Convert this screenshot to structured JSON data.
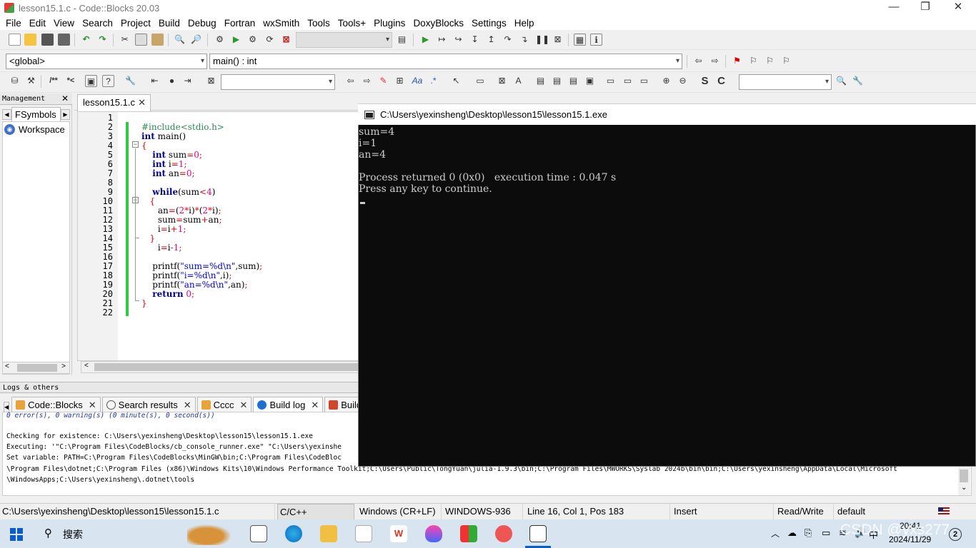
{
  "window": {
    "title": "lesson15.1.c - Code::Blocks 20.03",
    "minimize": "—",
    "maximize": "❐",
    "close": "✕"
  },
  "menu": [
    "File",
    "Edit",
    "View",
    "Search",
    "Project",
    "Build",
    "Debug",
    "Fortran",
    "wxSmith",
    "Tools",
    "Tools+",
    "Plugins",
    "DoxyBlocks",
    "Settings",
    "Help"
  ],
  "toolbar": {
    "scope_combo": "<global>",
    "function_combo": "main() : int"
  },
  "management": {
    "header": "Management",
    "tab": "FSymbols",
    "workspace": "Workspace"
  },
  "editor": {
    "tab": "lesson15.1.c",
    "line_numbers": [
      "1",
      "2",
      "3",
      "4",
      "5",
      "6",
      "7",
      "8",
      "9",
      "10",
      "11",
      "12",
      "13",
      "14",
      "15",
      "16",
      "17",
      "18",
      "19",
      "20",
      "21",
      "22"
    ]
  },
  "console": {
    "title": "C:\\Users\\yexinsheng\\Desktop\\lesson15\\lesson15.1.exe",
    "lines": [
      "sum=4",
      "i=1",
      "an=4",
      "",
      "Process returned 0 (0x0)   execution time : 0.047 s",
      "Press any key to continue."
    ]
  },
  "logs": {
    "header": "Logs & others",
    "tabs": [
      "Code::Blocks",
      "Search results",
      "Cccc",
      "Build log",
      "Build"
    ],
    "lines": [
      "0 error(s), 0 warning(s) (0 minute(s), 0 second(s))",
      "",
      "Checking for existence: C:\\Users\\yexinsheng\\Desktop\\lesson15\\lesson15.1.exe",
      "Executing: '\"C:\\Program Files\\CodeBlocks/cb_console_runner.exe\" \"C:\\Users\\yexinshe",
      "Set variable: PATH=C:\\Program Files\\CodeBlocks\\MinGW\\bin;C:\\Program Files\\CodeBloc",
      "\\Program Files\\dotnet;C:\\Program Files (x86)\\Windows Kits\\10\\Windows Performance Toolkit;C:\\Users\\Public\\TongYuan\\julia-1.9.3\\bin;C:\\Program Files\\MWORKS\\Syslab 2024b\\bin\\bin;C:\\Users\\yexinsheng\\AppData\\Local\\Microsoft",
      "\\WindowsApps;C:\\Users\\yexinsheng\\.dotnet\\tools"
    ]
  },
  "status": {
    "path": "C:\\Users\\yexinsheng\\Desktop\\lesson15\\lesson15.1.c",
    "lang": "C/C++",
    "eol": "Windows (CR+LF)",
    "encoding": "WINDOWS-936",
    "position": "Line 16, Col 1, Pos 183",
    "mode": "Insert",
    "access": "Read/Write",
    "profile": "default"
  },
  "taskbar": {
    "search": "搜索",
    "time": "20:41",
    "date": "2024/11/29",
    "watermark": "CSDN @yxs277",
    "notifications": "2"
  }
}
